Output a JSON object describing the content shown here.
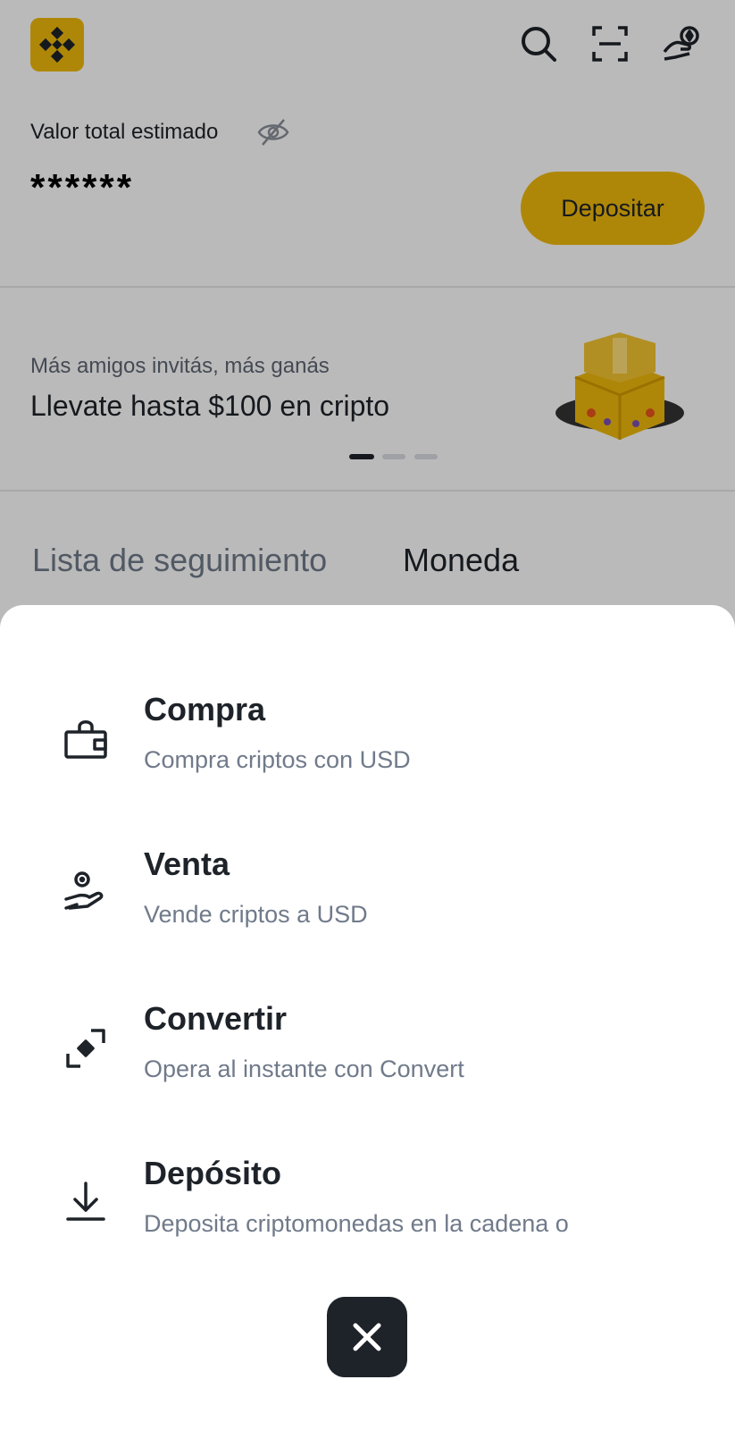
{
  "header": {
    "logo_icon": "binance-logo-icon",
    "actions": [
      "search-icon",
      "scan-icon",
      "support-icon"
    ]
  },
  "balance": {
    "label": "Valor total estimado",
    "value": "******",
    "deposit_label": "Depositar"
  },
  "promo": {
    "subtitle": "Más amigos invitás, más ganás",
    "title": "Llevate hasta $100 en cripto",
    "pager_count": 3,
    "pager_active": 0
  },
  "tabs": [
    {
      "label": "Lista de seguimiento"
    },
    {
      "label": "Moneda"
    }
  ],
  "sheet": {
    "items": [
      {
        "title": "Compra",
        "desc": "Compra criptos con USD",
        "icon": "wallet-icon"
      },
      {
        "title": "Venta",
        "desc": "Vende criptos a USD",
        "icon": "hand-coin-icon"
      },
      {
        "title": "Convertir",
        "desc": "Opera al instante con Convert",
        "icon": "convert-icon"
      },
      {
        "title": "Depósito",
        "desc": "Deposita criptomonedas en la cadena o",
        "icon": "download-icon"
      }
    ]
  },
  "colors": {
    "accent": "#f0b90b",
    "text_primary": "#1e2329",
    "text_secondary": "#707a8a"
  }
}
